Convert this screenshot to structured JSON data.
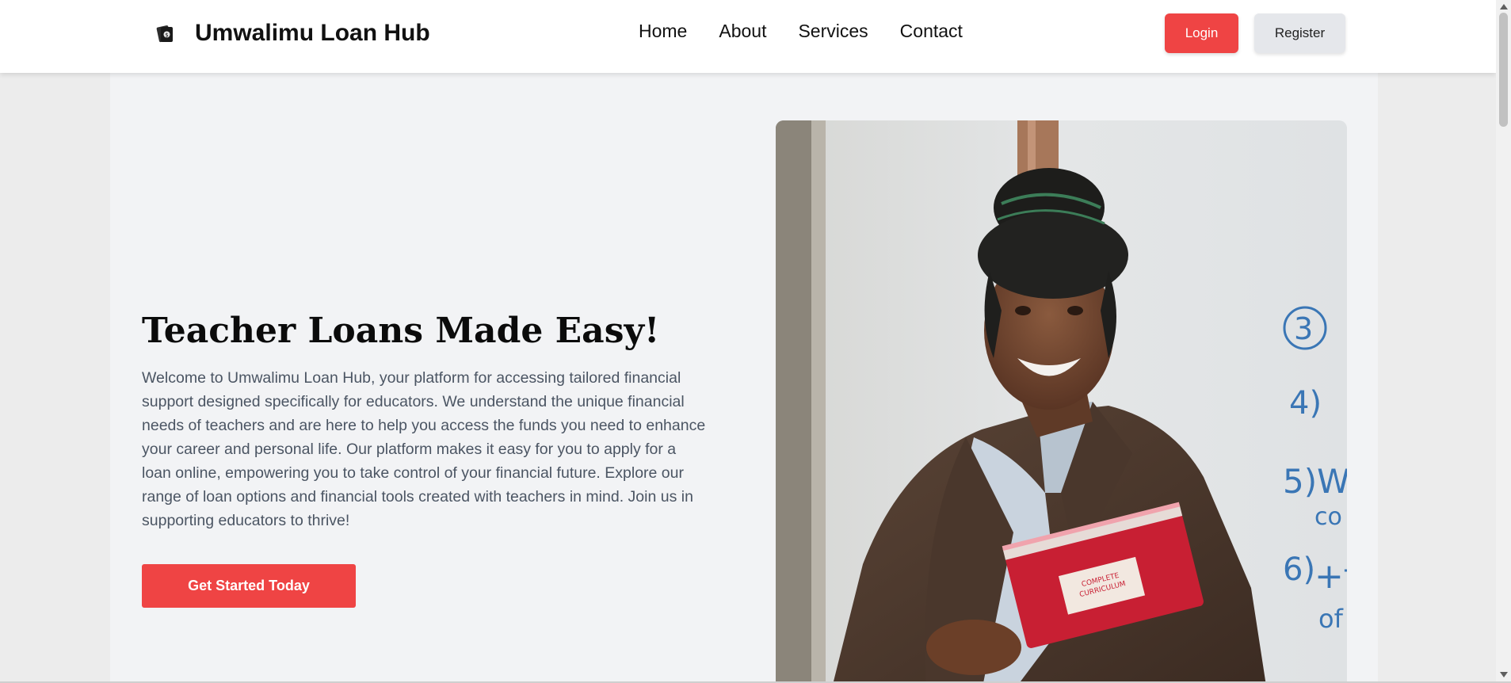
{
  "navbar": {
    "brand_icon": "money-stack-icon",
    "brand_name": "Umwalimu Loan Hub",
    "links": [
      {
        "label": "Home"
      },
      {
        "label": "About"
      },
      {
        "label": "Services"
      },
      {
        "label": "Contact"
      }
    ],
    "login_label": "Login",
    "register_label": "Register"
  },
  "hero": {
    "title": "Teacher Loans Made Easy!",
    "description": "Welcome to Umwalimu Loan Hub, your platform for accessing tailored financial support designed specifically for educators. We understand the unique financial needs of teachers and are here to help you access the funds you need to enhance your career and personal life. Our platform makes it easy for you to apply for a loan online, empowering you to take control of your financial future. Explore our range of loan options and financial tools created with teachers in mind. Join us in supporting educators to thrive!",
    "cta_label": "Get Started Today"
  },
  "colors": {
    "accent": "#ef4444",
    "hero_bg": "#f2f3f5",
    "page_bg": "#ececec"
  }
}
